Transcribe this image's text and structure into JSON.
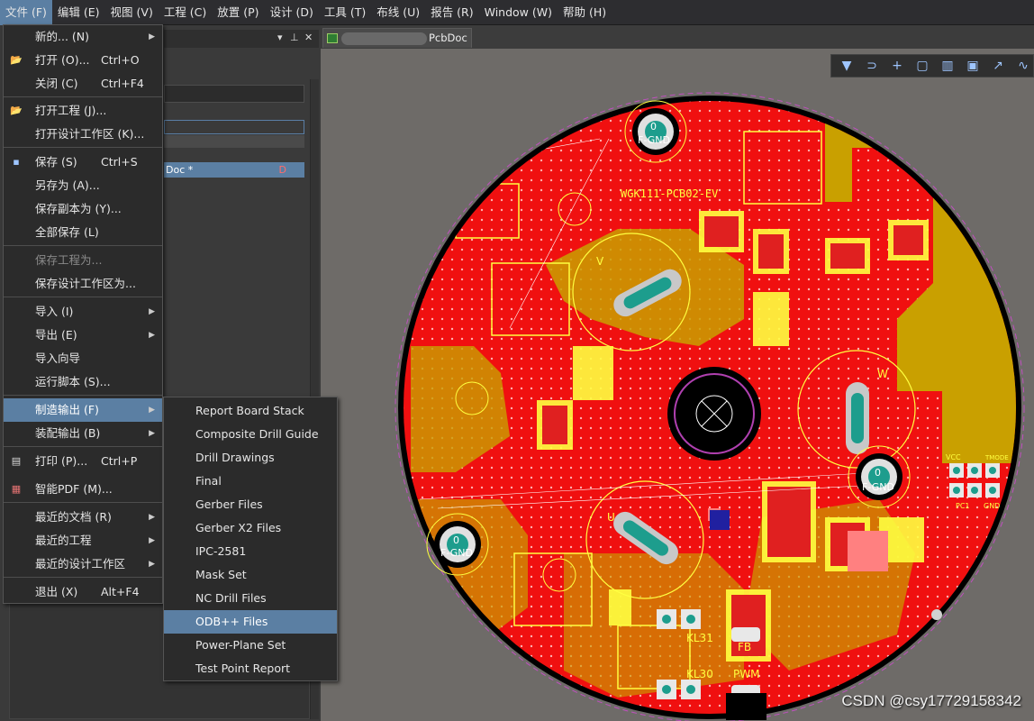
{
  "menubar": {
    "items": [
      "文件 (F)",
      "编辑 (E)",
      "视图 (V)",
      "工程 (C)",
      "放置 (P)",
      "设计 (D)",
      "工具 (T)",
      "布线 (U)",
      "报告 (R)",
      "Window (W)",
      "帮助 (H)"
    ]
  },
  "file_menu": {
    "items": [
      {
        "label": "新的... (N)",
        "submenu": true
      },
      {
        "label": "打开 (O)...",
        "shortcut": "Ctrl+O",
        "icon": "open-folder-icon"
      },
      {
        "label": "关闭 (C)",
        "shortcut": "Ctrl+F4"
      },
      {
        "label": "打开工程 (J)...",
        "icon": "open-project-icon"
      },
      {
        "label": "打开设计工作区 (K)..."
      },
      {
        "label": "保存 (S)",
        "shortcut": "Ctrl+S",
        "icon": "save-icon"
      },
      {
        "label": "另存为 (A)..."
      },
      {
        "label": "保存副本为 (Y)..."
      },
      {
        "label": "全部保存 (L)"
      },
      {
        "label": "保存工程为...",
        "disabled": true
      },
      {
        "label": "保存设计工作区为..."
      },
      {
        "label": "导入 (I)",
        "submenu": true
      },
      {
        "label": "导出 (E)",
        "submenu": true
      },
      {
        "label": "导入向导"
      },
      {
        "label": "运行脚本 (S)..."
      },
      {
        "label": "制造输出 (F)",
        "submenu": true,
        "highlighted": true
      },
      {
        "label": "装配输出 (B)",
        "submenu": true
      },
      {
        "label": "打印 (P)...",
        "shortcut": "Ctrl+P",
        "icon": "print-icon"
      },
      {
        "label": "智能PDF (M)...",
        "icon": "pdf-icon"
      },
      {
        "label": "最近的文档 (R)",
        "submenu": true
      },
      {
        "label": "最近的工程",
        "submenu": true
      },
      {
        "label": "最近的设计工作区",
        "submenu": true
      },
      {
        "label": "退出 (X)",
        "shortcut": "Alt+F4"
      }
    ]
  },
  "fab_submenu": {
    "items": [
      "Report Board Stack",
      "Composite Drill Guide",
      "Drill Drawings",
      "Final",
      "Gerber Files",
      "Gerber X2 Files",
      "IPC-2581",
      "Mask Set",
      "NC Drill Files",
      "ODB++ Files",
      "Power-Plane Set",
      "Test Point Report"
    ],
    "highlighted_index": 9
  },
  "document_tab": {
    "label": "PcbDoc *"
  },
  "panel": {
    "selected_doc": "Doc *",
    "modified_marker": "D"
  },
  "pcb": {
    "board_label": "WGK111-PCB02-EV",
    "mount_label_value": "0",
    "mount_label_net": "F-GND",
    "phase_labels": [
      "V",
      "W",
      "U"
    ],
    "connector_labels": [
      "KL31",
      "KL30",
      "FB",
      "PWM",
      "VCC",
      "PC1",
      "GND",
      "TMODE"
    ],
    "colors": {
      "board": "#f01010",
      "copper": "#c9a000",
      "silk": "#ffff40",
      "background": "#6e6b68",
      "edge": "#000000"
    }
  },
  "watermark": "CSDN @csy17729158342"
}
